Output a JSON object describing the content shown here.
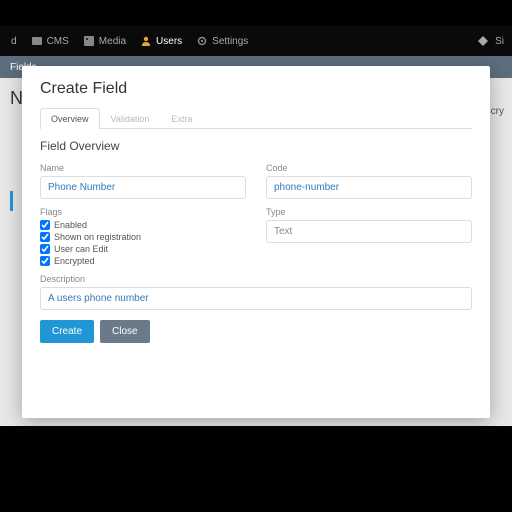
{
  "nav": {
    "items": [
      {
        "label": "d"
      },
      {
        "label": "CMS"
      },
      {
        "label": "Media"
      },
      {
        "label": "Users"
      },
      {
        "label": "Settings"
      }
    ],
    "right": {
      "label": "Si"
    }
  },
  "breadcrumb": {
    "label": "Fields"
  },
  "page": {
    "title": "N",
    "right_col": "Encry"
  },
  "modal": {
    "title": "Create Field",
    "tabs": [
      {
        "label": "Overview"
      },
      {
        "label": "Validation"
      },
      {
        "label": "Extra"
      }
    ],
    "section": "Field Overview",
    "name_label": "Name",
    "name_value": "Phone Number",
    "code_label": "Code",
    "code_value": "phone-number",
    "flags_label": "Flags",
    "flags": [
      {
        "label": "Enabled"
      },
      {
        "label": "Shown on registration"
      },
      {
        "label": "User can Edit"
      },
      {
        "label": "Encrypted"
      }
    ],
    "type_label": "Type",
    "type_value": "Text",
    "desc_label": "Description",
    "desc_value": "A users phone number",
    "create_btn": "Create",
    "close_btn": "Close"
  }
}
